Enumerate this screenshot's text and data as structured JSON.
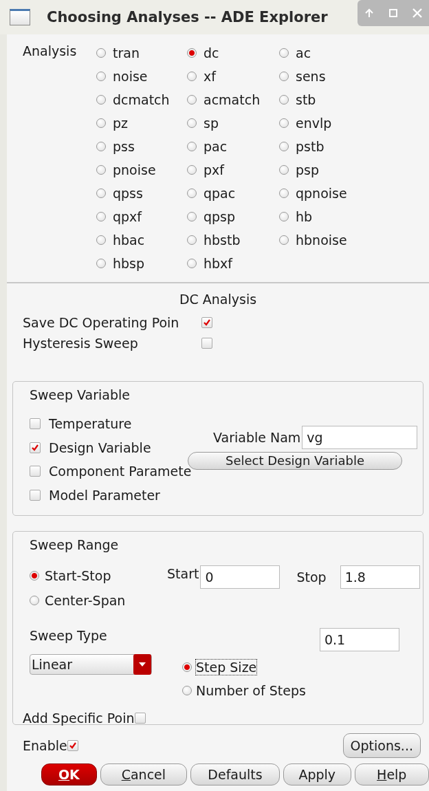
{
  "window": {
    "title": "Choosing Analyses -- ADE Explorer",
    "controls": [
      {
        "kind": "up"
      },
      {
        "kind": "maximize"
      },
      {
        "kind": "close"
      }
    ]
  },
  "analysis": {
    "label": "Analysis",
    "options": [
      {
        "label": "tran",
        "selected": false
      },
      {
        "label": "dc",
        "selected": true
      },
      {
        "label": "ac",
        "selected": false
      },
      {
        "label": "noise",
        "selected": false
      },
      {
        "label": "xf",
        "selected": false
      },
      {
        "label": "sens",
        "selected": false
      },
      {
        "label": "dcmatch",
        "selected": false
      },
      {
        "label": "acmatch",
        "selected": false
      },
      {
        "label": "stb",
        "selected": false
      },
      {
        "label": "pz",
        "selected": false
      },
      {
        "label": "sp",
        "selected": false
      },
      {
        "label": "envlp",
        "selected": false
      },
      {
        "label": "pss",
        "selected": false
      },
      {
        "label": "pac",
        "selected": false
      },
      {
        "label": "pstb",
        "selected": false
      },
      {
        "label": "pnoise",
        "selected": false
      },
      {
        "label": "pxf",
        "selected": false
      },
      {
        "label": "psp",
        "selected": false
      },
      {
        "label": "qpss",
        "selected": false
      },
      {
        "label": "qpac",
        "selected": false
      },
      {
        "label": "qpnoise",
        "selected": false
      },
      {
        "label": "qpxf",
        "selected": false
      },
      {
        "label": "qpsp",
        "selected": false
      },
      {
        "label": "hb",
        "selected": false
      },
      {
        "label": "hbac",
        "selected": false
      },
      {
        "label": "hbstb",
        "selected": false
      },
      {
        "label": "hbnoise",
        "selected": false
      },
      {
        "label": "hbsp",
        "selected": false
      },
      {
        "label": "hbxf",
        "selected": false
      }
    ]
  },
  "section_title": "DC Analysis",
  "options": [
    {
      "label": "Save DC Operating Poin",
      "checked": true
    },
    {
      "label": "Hysteresis Sweep",
      "checked": false
    }
  ],
  "sweep_variable": {
    "title": "Sweep Variable",
    "choices": [
      {
        "label": "Temperature",
        "checked": false
      },
      {
        "label": "Design Variable",
        "checked": true
      },
      {
        "label": "Component Paramete",
        "checked": false
      },
      {
        "label": "Model Parameter",
        "checked": false
      }
    ],
    "variable_name": {
      "label": "Variable Nam",
      "value": "vg"
    },
    "select_button": "Select Design Variable"
  },
  "sweep_range": {
    "title": "Sweep Range",
    "modes": [
      {
        "label": "Start-Stop",
        "selected": true
      },
      {
        "label": "Center-Span",
        "selected": false
      }
    ],
    "start": {
      "label": "Start",
      "value": "0"
    },
    "stop": {
      "label": "Stop",
      "value": "1.8"
    },
    "sweep_type": {
      "label": "Sweep Type",
      "value": "Linear"
    },
    "step_modes": [
      {
        "label": "Step Size",
        "selected": true
      },
      {
        "label": "Number of Steps",
        "selected": false
      }
    ],
    "step_value": "0.1",
    "specific_points": {
      "label": "Add Specific Poin",
      "checked": false
    }
  },
  "enabled": {
    "label": "Enable",
    "checked": true
  },
  "options_button": "Options...",
  "buttons": [
    {
      "accel": "O",
      "rest": "K",
      "kind": "primary"
    },
    {
      "accel": "C",
      "rest": "ancel",
      "kind": "normal"
    },
    {
      "rest": "Defaults",
      "kind": "normal"
    },
    {
      "rest": "Apply",
      "kind": "normal"
    },
    {
      "accel": "H",
      "rest": "elp",
      "kind": "normal"
    }
  ]
}
